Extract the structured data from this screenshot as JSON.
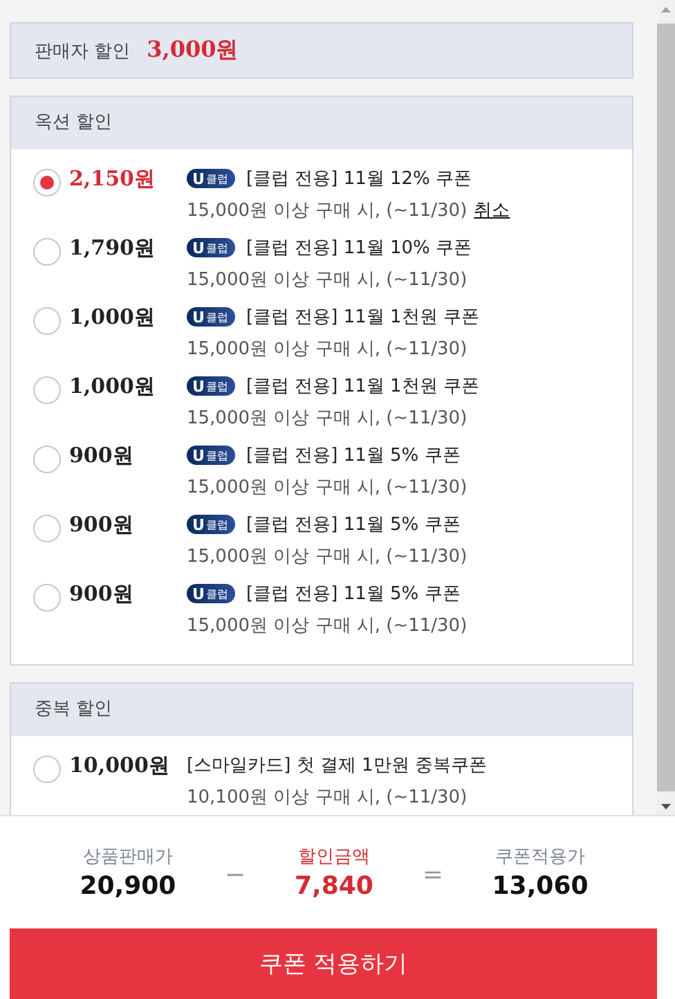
{
  "seller_discount": {
    "label": "판매자 할인",
    "amount": "3,000원"
  },
  "sections": [
    {
      "title": "옥션 할인",
      "options": [
        {
          "price": "2,150원",
          "selected": true,
          "badge": {
            "mark": "U",
            "text": "클럽"
          },
          "title": "[클럽 전용] 11월 12% 쿠폰",
          "condition": "15,000원 이상 구매 시, (~11/30)",
          "cancel_link": "취소"
        },
        {
          "price": "1,790원",
          "selected": false,
          "badge": {
            "mark": "U",
            "text": "클럽"
          },
          "title": "[클럽 전용] 11월 10% 쿠폰",
          "condition": "15,000원 이상 구매 시, (~11/30)"
        },
        {
          "price": "1,000원",
          "selected": false,
          "badge": {
            "mark": "U",
            "text": "클럽"
          },
          "title": "[클럽 전용] 11월 1천원 쿠폰",
          "condition": "15,000원 이상 구매 시, (~11/30)"
        },
        {
          "price": "1,000원",
          "selected": false,
          "badge": {
            "mark": "U",
            "text": "클럽"
          },
          "title": "[클럽 전용] 11월 1천원 쿠폰",
          "condition": "15,000원 이상 구매 시, (~11/30)"
        },
        {
          "price": "900원",
          "selected": false,
          "badge": {
            "mark": "U",
            "text": "클럽"
          },
          "title": "[클럽 전용] 11월 5% 쿠폰",
          "condition": "15,000원 이상 구매 시, (~11/30)"
        },
        {
          "price": "900원",
          "selected": false,
          "badge": {
            "mark": "U",
            "text": "클럽"
          },
          "title": "[클럽 전용] 11월 5% 쿠폰",
          "condition": "15,000원 이상 구매 시, (~11/30)"
        },
        {
          "price": "900원",
          "selected": false,
          "badge": {
            "mark": "U",
            "text": "클럽"
          },
          "title": "[클럽 전용] 11월 5% 쿠폰",
          "condition": "15,000원 이상 구매 시, (~11/30)"
        }
      ]
    },
    {
      "title": "중복 할인",
      "options": [
        {
          "price": "10,000원",
          "selected": false,
          "title": "[스마일카드] 첫 결제 1만원 중복쿠폰",
          "condition": "10,100원 이상 구매 시, (~11/30)"
        }
      ]
    }
  ],
  "summary": {
    "items": [
      {
        "kind": "value",
        "label": "상품판매가",
        "value": "20,900"
      },
      {
        "kind": "operator",
        "symbol": "−"
      },
      {
        "kind": "discount",
        "label": "할인금액",
        "value": "7,840"
      },
      {
        "kind": "operator",
        "symbol": "="
      },
      {
        "kind": "value",
        "label": "쿠폰적용가",
        "value": "13,060"
      }
    ]
  },
  "apply_button": "쿠폰 적용하기"
}
